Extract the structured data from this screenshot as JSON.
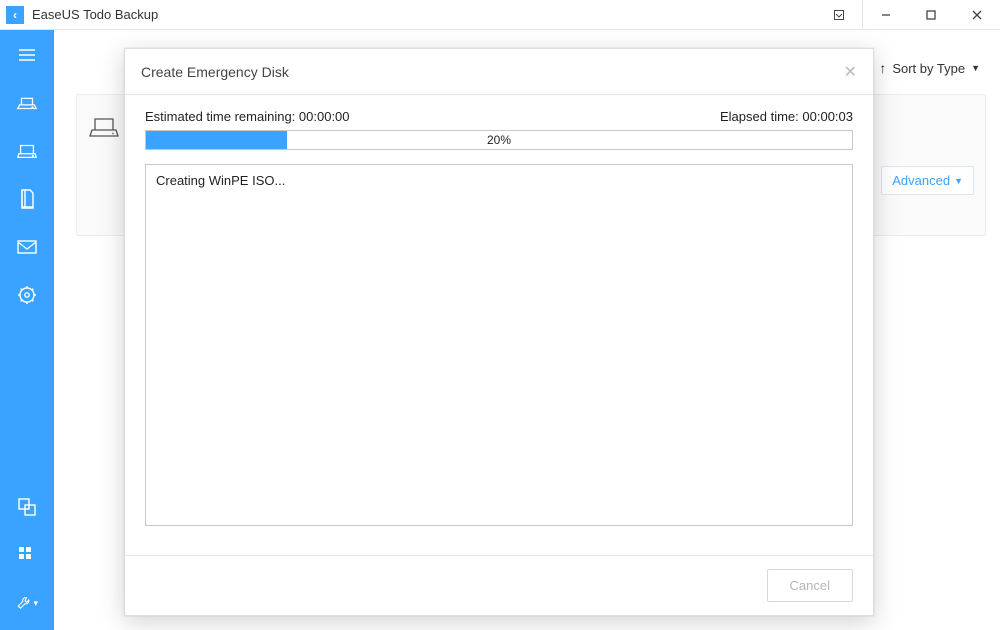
{
  "titlebar": {
    "app_name": "EaseUS Todo Backup",
    "app_icon_glyph": "‹"
  },
  "top_controls": {
    "sort_label": "Sort by Type"
  },
  "advanced": {
    "label": "Advanced"
  },
  "modal": {
    "title": "Create Emergency Disk",
    "estimated_label": "Estimated time remaining:",
    "estimated_value": "00:00:00",
    "elapsed_label": "Elapsed time:",
    "elapsed_value": "00:00:03",
    "progress_percent": 20,
    "progress_text": "20%",
    "log_line1": "Creating WinPE ISO...",
    "cancel_label": "Cancel"
  },
  "colors": {
    "accent": "#3aa3ff"
  }
}
